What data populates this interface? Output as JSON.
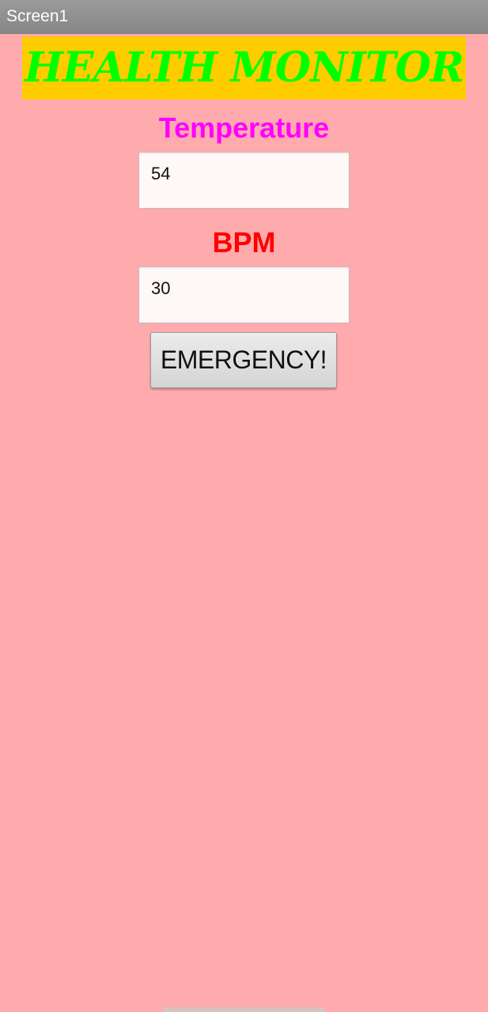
{
  "window": {
    "title": "Screen1"
  },
  "header": {
    "title": "HEALTH MONITOR"
  },
  "temperature": {
    "label": "Temperature",
    "value": "54"
  },
  "bpm": {
    "label": "BPM",
    "value": "30"
  },
  "actions": {
    "emergency_label": "EMERGENCY!"
  },
  "colors": {
    "background": "#ffaaad",
    "titlebar": "#8e8e8e",
    "header_background": "#ffcc00",
    "header_text": "#00ff00",
    "temperature_label": "#ff00ff",
    "bpm_label": "#ff0000"
  }
}
